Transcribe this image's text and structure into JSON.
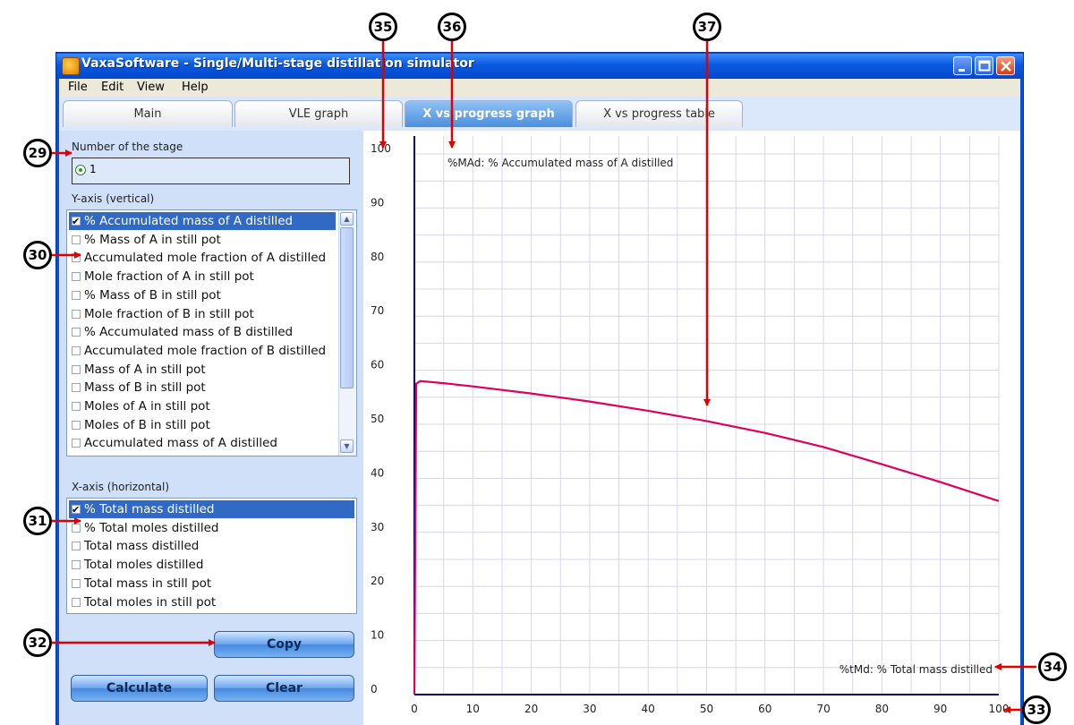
{
  "window": {
    "title": "VaxaSoftware - Single/Multi-stage distillation simulator",
    "controls": {
      "minimize": "minimize-icon",
      "maximize": "maximize-icon",
      "close": "close-icon"
    }
  },
  "menu": [
    "File",
    "Edit",
    "View",
    "Help"
  ],
  "tabs": [
    {
      "label": "Main",
      "active": false
    },
    {
      "label": "VLE graph",
      "active": false
    },
    {
      "label": "X vs progress graph",
      "active": true
    },
    {
      "label": "X vs progress table",
      "active": false
    }
  ],
  "left_panel": {
    "stage_label": "Number of the stage",
    "stage_value": "1",
    "y_axis_label": "Y-axis (vertical)",
    "y_options": [
      {
        "label": "% Accumulated mass of A distilled",
        "checked": true,
        "selected": true
      },
      {
        "label": "% Mass of A in still pot",
        "checked": false
      },
      {
        "label": "Accumulated mole fraction of A distilled",
        "checked": false
      },
      {
        "label": "Mole fraction of A in still pot",
        "checked": false
      },
      {
        "label": "% Mass of B in still pot",
        "checked": false
      },
      {
        "label": "Mole fraction of B in still pot",
        "checked": false
      },
      {
        "label": "% Accumulated mass of B distilled",
        "checked": false
      },
      {
        "label": "Accumulated mole fraction of B distilled",
        "checked": false
      },
      {
        "label": "Mass of A in still pot",
        "checked": false
      },
      {
        "label": "Mass of B in still pot",
        "checked": false
      },
      {
        "label": "Moles of A in still pot",
        "checked": false
      },
      {
        "label": "Moles of B in still pot",
        "checked": false
      },
      {
        "label": "Accumulated mass of A distilled",
        "checked": false
      }
    ],
    "x_axis_label": "X-axis (horizontal)",
    "x_options": [
      {
        "label": "% Total mass distilled",
        "checked": true,
        "selected": true
      },
      {
        "label": "% Total moles distilled",
        "checked": false
      },
      {
        "label": "Total mass distilled",
        "checked": false
      },
      {
        "label": "Total moles distilled",
        "checked": false
      },
      {
        "label": "Total mass in still pot",
        "checked": false
      },
      {
        "label": "Total moles in still pot",
        "checked": false
      }
    ],
    "buttons": {
      "copy": "Copy",
      "calculate": "Calculate",
      "clear": "Clear"
    }
  },
  "annotations": [
    "29",
    "30",
    "31",
    "32",
    "33",
    "34",
    "35",
    "36",
    "37"
  ],
  "chart_data": {
    "type": "line",
    "title": "",
    "ylabel": "%MAd: % Accumulated mass of A distilled",
    "xlabel": "%tMd: % Total mass distilled",
    "xlim": [
      0,
      100
    ],
    "ylim": [
      0,
      100
    ],
    "x_ticks": [
      "0",
      "10",
      "20",
      "30",
      "40",
      "50",
      "60",
      "70",
      "80",
      "90",
      "100"
    ],
    "y_ticks": [
      "0",
      "10",
      "20",
      "30",
      "40",
      "50",
      "60",
      "70",
      "80",
      "90",
      "100"
    ],
    "grid": true,
    "line_color": "#e0005a",
    "series": [
      {
        "x": [
          0,
          0.3,
          1,
          5,
          10,
          20,
          30,
          40,
          50,
          60,
          70,
          80,
          90,
          100
        ],
        "y": [
          0,
          57.5,
          58.0,
          57.6,
          57.0,
          55.7,
          54.2,
          52.5,
          50.6,
          48.4,
          45.8,
          42.6,
          39.3,
          35.8
        ]
      }
    ]
  }
}
